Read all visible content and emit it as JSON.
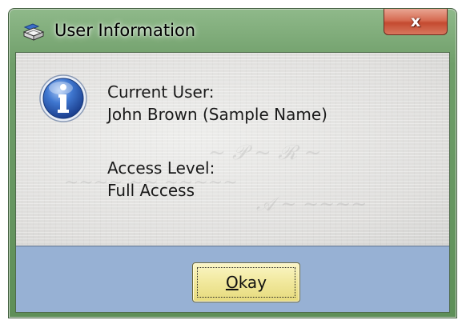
{
  "window": {
    "title": "User Information",
    "close_label": "x"
  },
  "icons": {
    "app": "user-info-app-icon",
    "info": "information-icon",
    "close": "close-icon"
  },
  "content": {
    "current_user_label": "Current User:",
    "current_user_value": "John Brown (Sample Name)",
    "access_level_label": "Access Level:",
    "access_level_value": "Full Access"
  },
  "buttons": {
    "okay_mnemonic": "O",
    "okay_rest": "kay"
  },
  "colors": {
    "title_bar": "#6f9e69",
    "close_button": "#c44a30",
    "content_background": "#e4e4e2",
    "button_area": "#97b1d4",
    "okay_button": "#f1e89c",
    "info_icon": "#2b5fb8"
  }
}
